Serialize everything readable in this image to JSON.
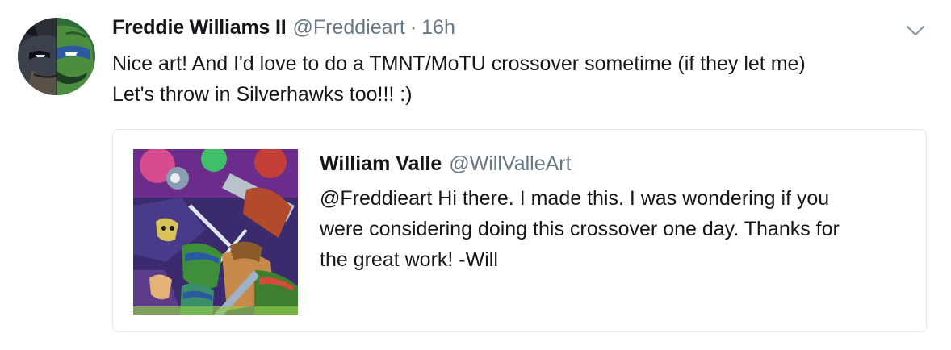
{
  "tweet": {
    "author_name": "Freddie Williams II",
    "author_handle": "@Freddieart",
    "separator": "·",
    "time": "16h",
    "text_lines": [
      "Nice art! And I'd love to do a TMNT/MoTU crossover sometime (if they let me)",
      "Let's throw in Silverhawks too!!! :)"
    ],
    "avatar_icon": "batman-ninja-turtle-split-face-avatar",
    "menu_icon": "chevron-down-icon"
  },
  "quote": {
    "author_name": "William Valle",
    "author_handle": "@WillValleArt",
    "text_lines": [
      "@Freddieart Hi there. I made this. I was wondering if you",
      "were considering doing this crossover one day. Thanks for",
      "the great work! -Will"
    ],
    "media_icon": "crossover-artwork-image"
  },
  "colors": {
    "text_primary": "#14171a",
    "text_secondary": "#657786",
    "card_border": "#e1e8ed",
    "background": "#ffffff"
  }
}
